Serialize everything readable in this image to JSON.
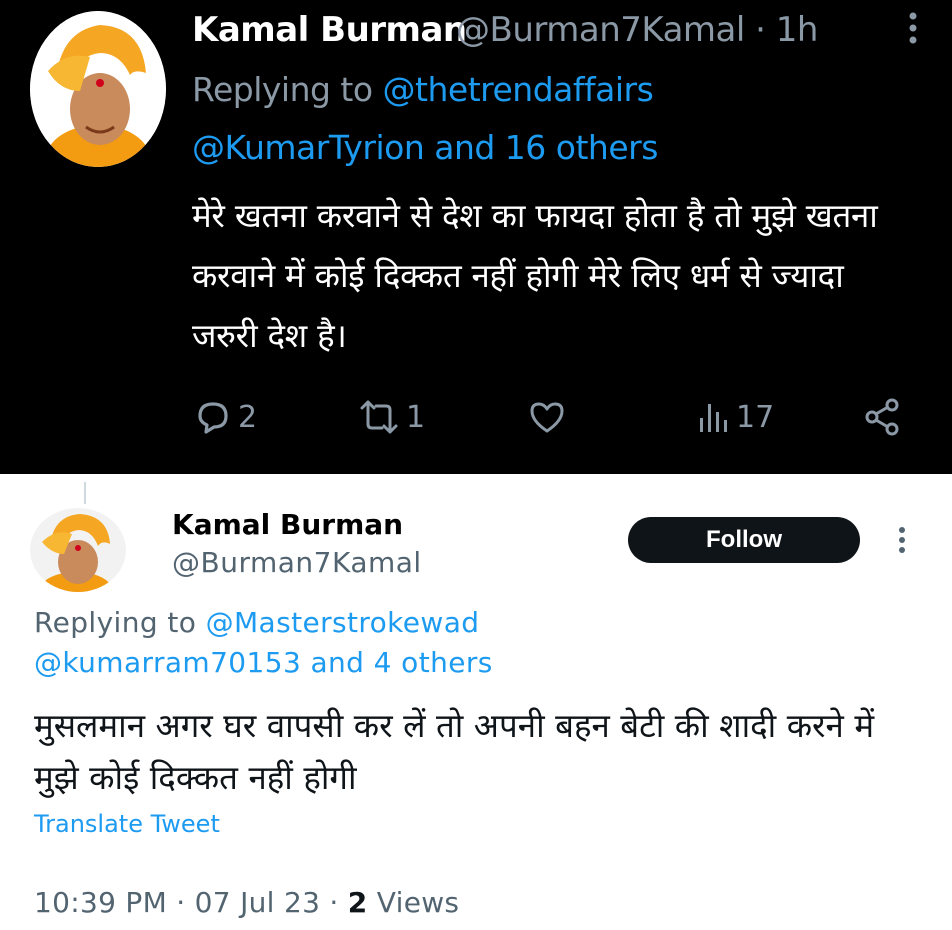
{
  "top_tweet": {
    "author_name": "Kamal Burman",
    "author_handle": "@Burman7Kamal",
    "time": "· 1h",
    "replying_prefix": "Replying to ",
    "replying_first": "@thetrendaffairs",
    "replying_rest": "@KumarTyrion and 16 others",
    "body": "मेरे खतना करवाने से देश का फायदा होता है तो मुझे खतना करवाने में कोई दिक्कत नहीं होगी मेरे लिए धर्म से ज्यादा जरुरी देश है।",
    "actions": {
      "reply_count": "2",
      "retweet_count": "1",
      "views_count": "17"
    }
  },
  "bottom_tweet": {
    "author_name": "Kamal Burman",
    "author_handle": "@Burman7Kamal",
    "follow_label": "Follow",
    "replying_prefix": "Replying to ",
    "replying_first": "@Masterstrokewad",
    "replying_rest": "@kumarram70153 and 4 others",
    "body": "मुसलमान अगर घर वापसी कर लें तो अपनी बहन बेटी की शादी करने में मुझे कोई दिक्कत नहीं होगी",
    "translate_label": "Translate Tweet",
    "meta_time": "10:39 PM · 07 Jul 23 · ",
    "meta_views_count": "2",
    "meta_views_label": " Views"
  },
  "icons": {
    "more": "more-vertical-icon",
    "reply": "reply-icon",
    "retweet": "retweet-icon",
    "like": "heart-icon",
    "views": "views-icon",
    "share": "share-icon"
  },
  "colors": {
    "link_blue": "#1d9bf0",
    "dark_bg": "#000000",
    "muted_dark": "#8b98a5",
    "muted_light": "#536471",
    "avatar_turban": "#f5a623"
  }
}
